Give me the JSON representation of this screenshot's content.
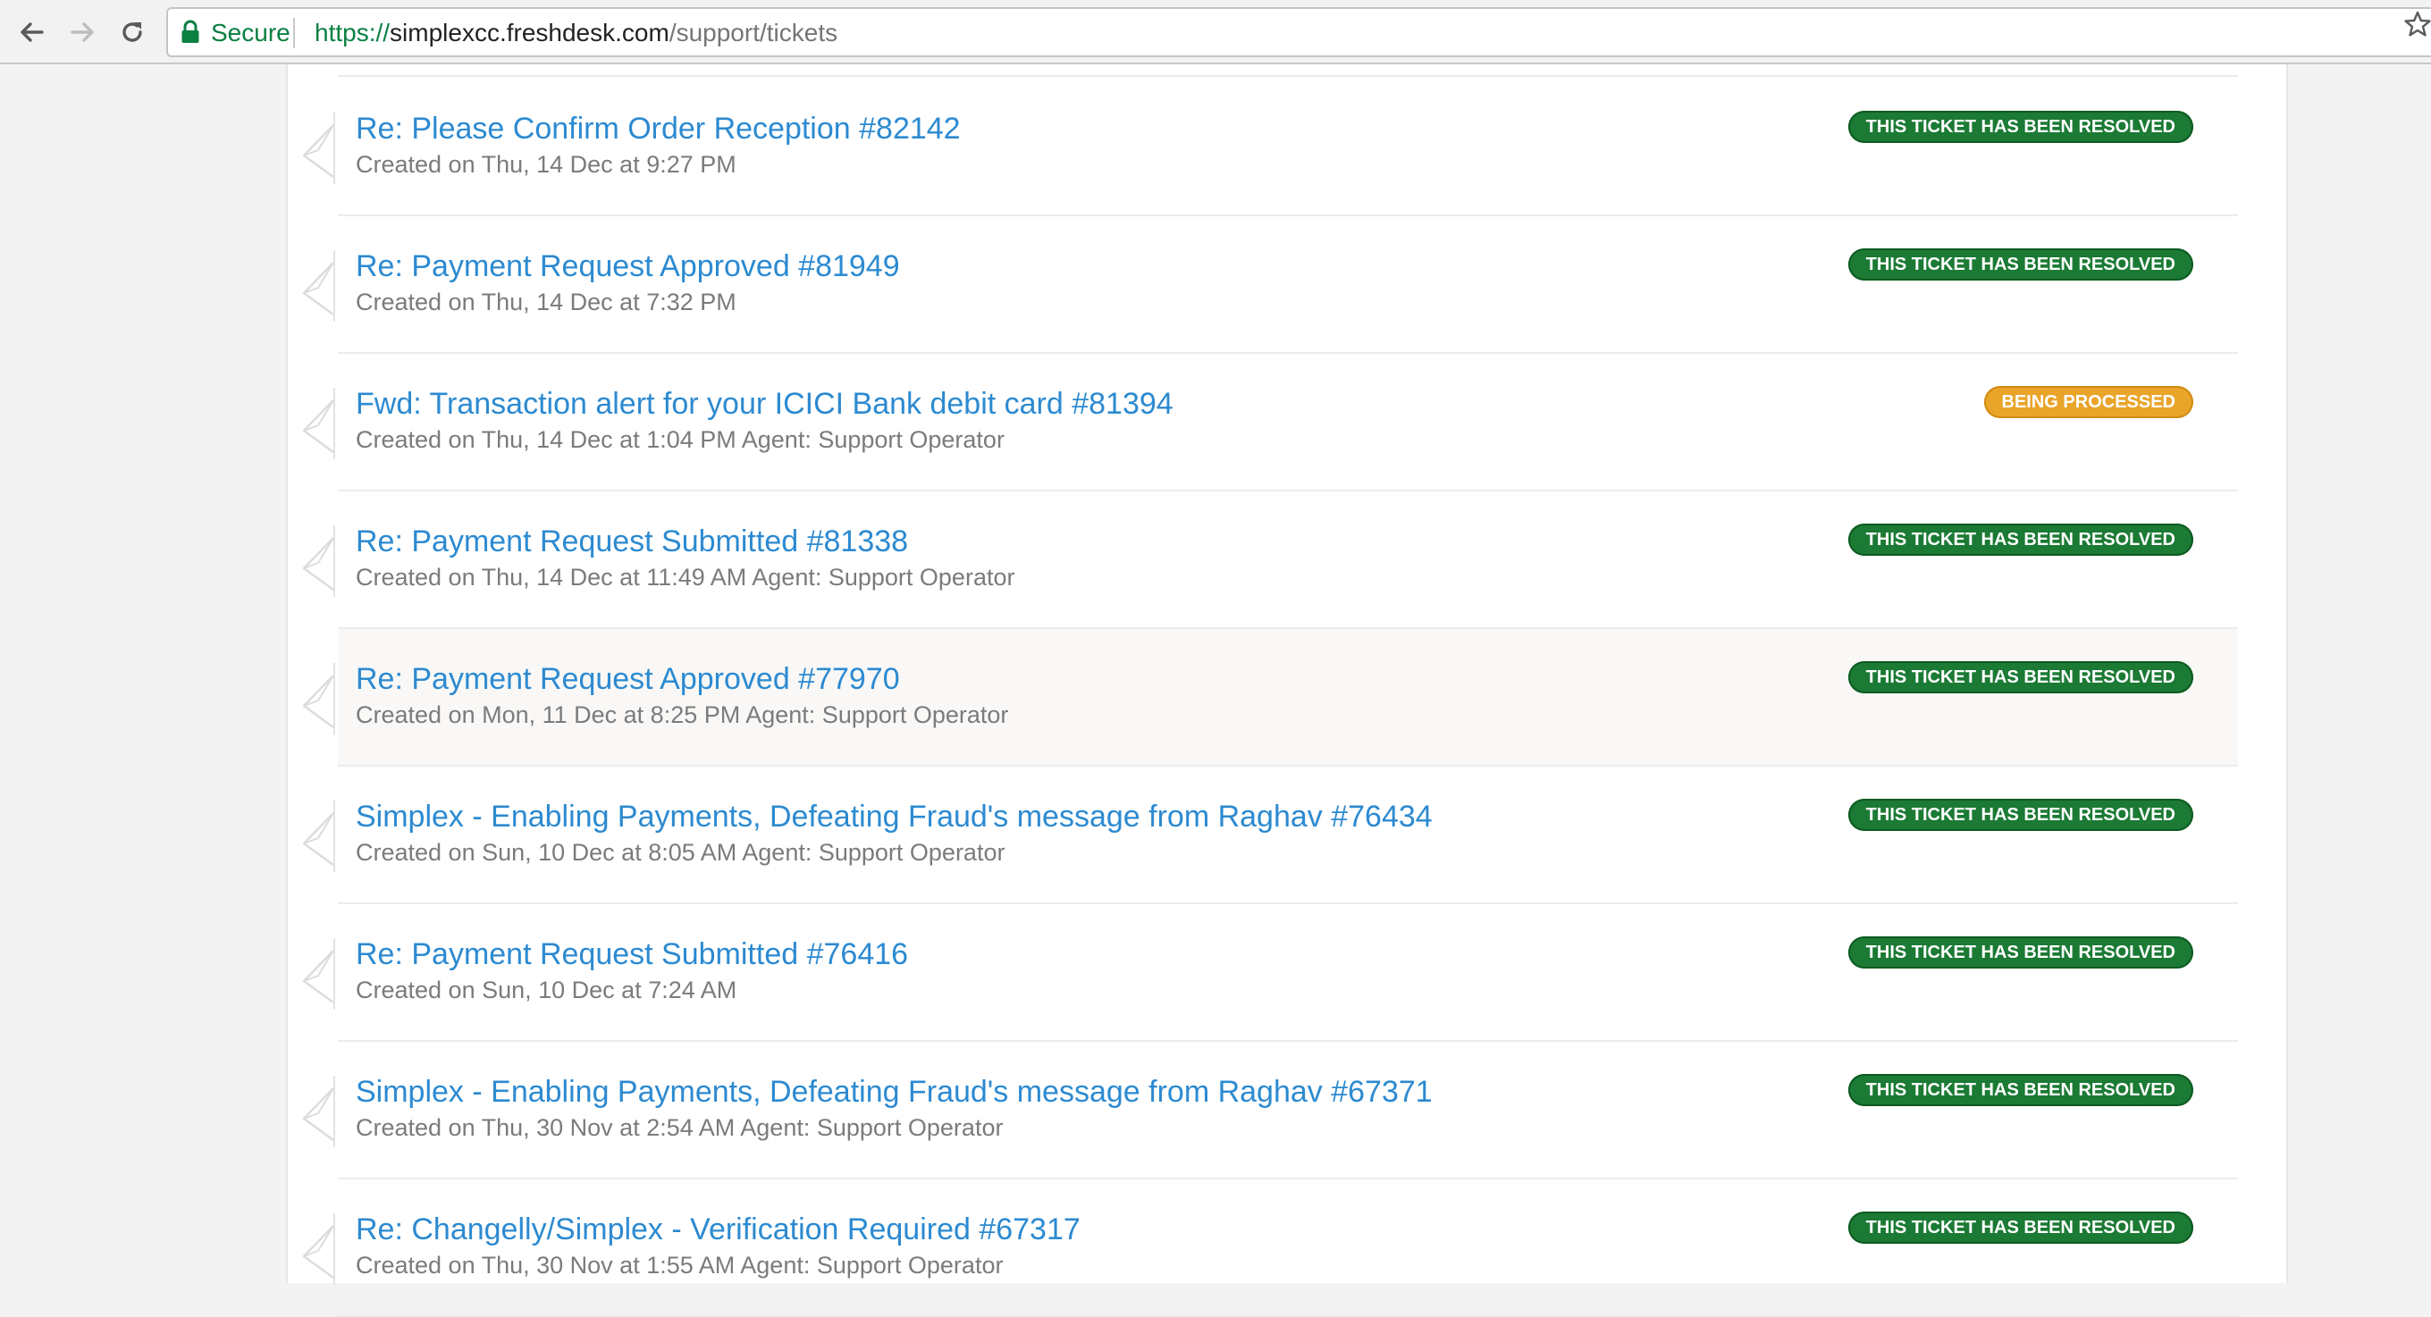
{
  "browser": {
    "secure_label": "Secure",
    "url_scheme": "https://",
    "url_host": "simplexcc.freshdesk.com",
    "url_path": "/support/tickets"
  },
  "tickets": [
    {
      "title": "Re: Please Confirm Order Reception #82142",
      "meta": "Created on Thu, 14 Dec at 9:27 PM",
      "status": "THIS TICKET HAS BEEN RESOLVED",
      "status_type": "resolved"
    },
    {
      "title": "Re: Payment Request Approved #81949",
      "meta": "Created on Thu, 14 Dec at 7:32 PM",
      "status": "THIS TICKET HAS BEEN RESOLVED",
      "status_type": "resolved"
    },
    {
      "title": "Fwd: Transaction alert for your ICICI Bank debit card #81394",
      "meta": "Created on Thu, 14 Dec at 1:04 PM Agent: Support Operator",
      "status": "BEING PROCESSED",
      "status_type": "processing"
    },
    {
      "title": "Re: Payment Request Submitted #81338",
      "meta": "Created on Thu, 14 Dec at 11:49 AM Agent: Support Operator",
      "status": "THIS TICKET HAS BEEN RESOLVED",
      "status_type": "resolved"
    },
    {
      "title": "Re: Payment Request Approved #77970",
      "meta": "Created on Mon, 11 Dec at 8:25 PM Agent: Support Operator",
      "status": "THIS TICKET HAS BEEN RESOLVED",
      "status_type": "resolved"
    },
    {
      "title": "Simplex - Enabling Payments, Defeating Fraud's message from Raghav #76434",
      "meta": "Created on Sun, 10 Dec at 8:05 AM Agent: Support Operator",
      "status": "THIS TICKET HAS BEEN RESOLVED",
      "status_type": "resolved"
    },
    {
      "title": "Re: Payment Request Submitted #76416",
      "meta": "Created on Sun, 10 Dec at 7:24 AM",
      "status": "THIS TICKET HAS BEEN RESOLVED",
      "status_type": "resolved"
    },
    {
      "title": "Simplex - Enabling Payments, Defeating Fraud's message from Raghav #67371",
      "meta": "Created on Thu, 30 Nov at 2:54 AM Agent: Support Operator",
      "status": "THIS TICKET HAS BEEN RESOLVED",
      "status_type": "resolved"
    },
    {
      "title": "Re: Changelly/Simplex - Verification Required #67317",
      "meta": "Created on Thu, 30 Nov at 1:55 AM Agent: Support Operator",
      "status": "THIS TICKET HAS BEEN RESOLVED",
      "status_type": "resolved"
    }
  ],
  "colors": {
    "link": "#2c8ad1",
    "resolved": "#1b7a34",
    "processing": "#e9a42a",
    "secure": "#0b8043"
  },
  "icons": {
    "back": "back-arrow-icon",
    "forward": "forward-arrow-icon",
    "reload": "reload-icon",
    "lock": "lock-icon",
    "bookmark": "star-icon",
    "ticket": "ticket-icon"
  }
}
